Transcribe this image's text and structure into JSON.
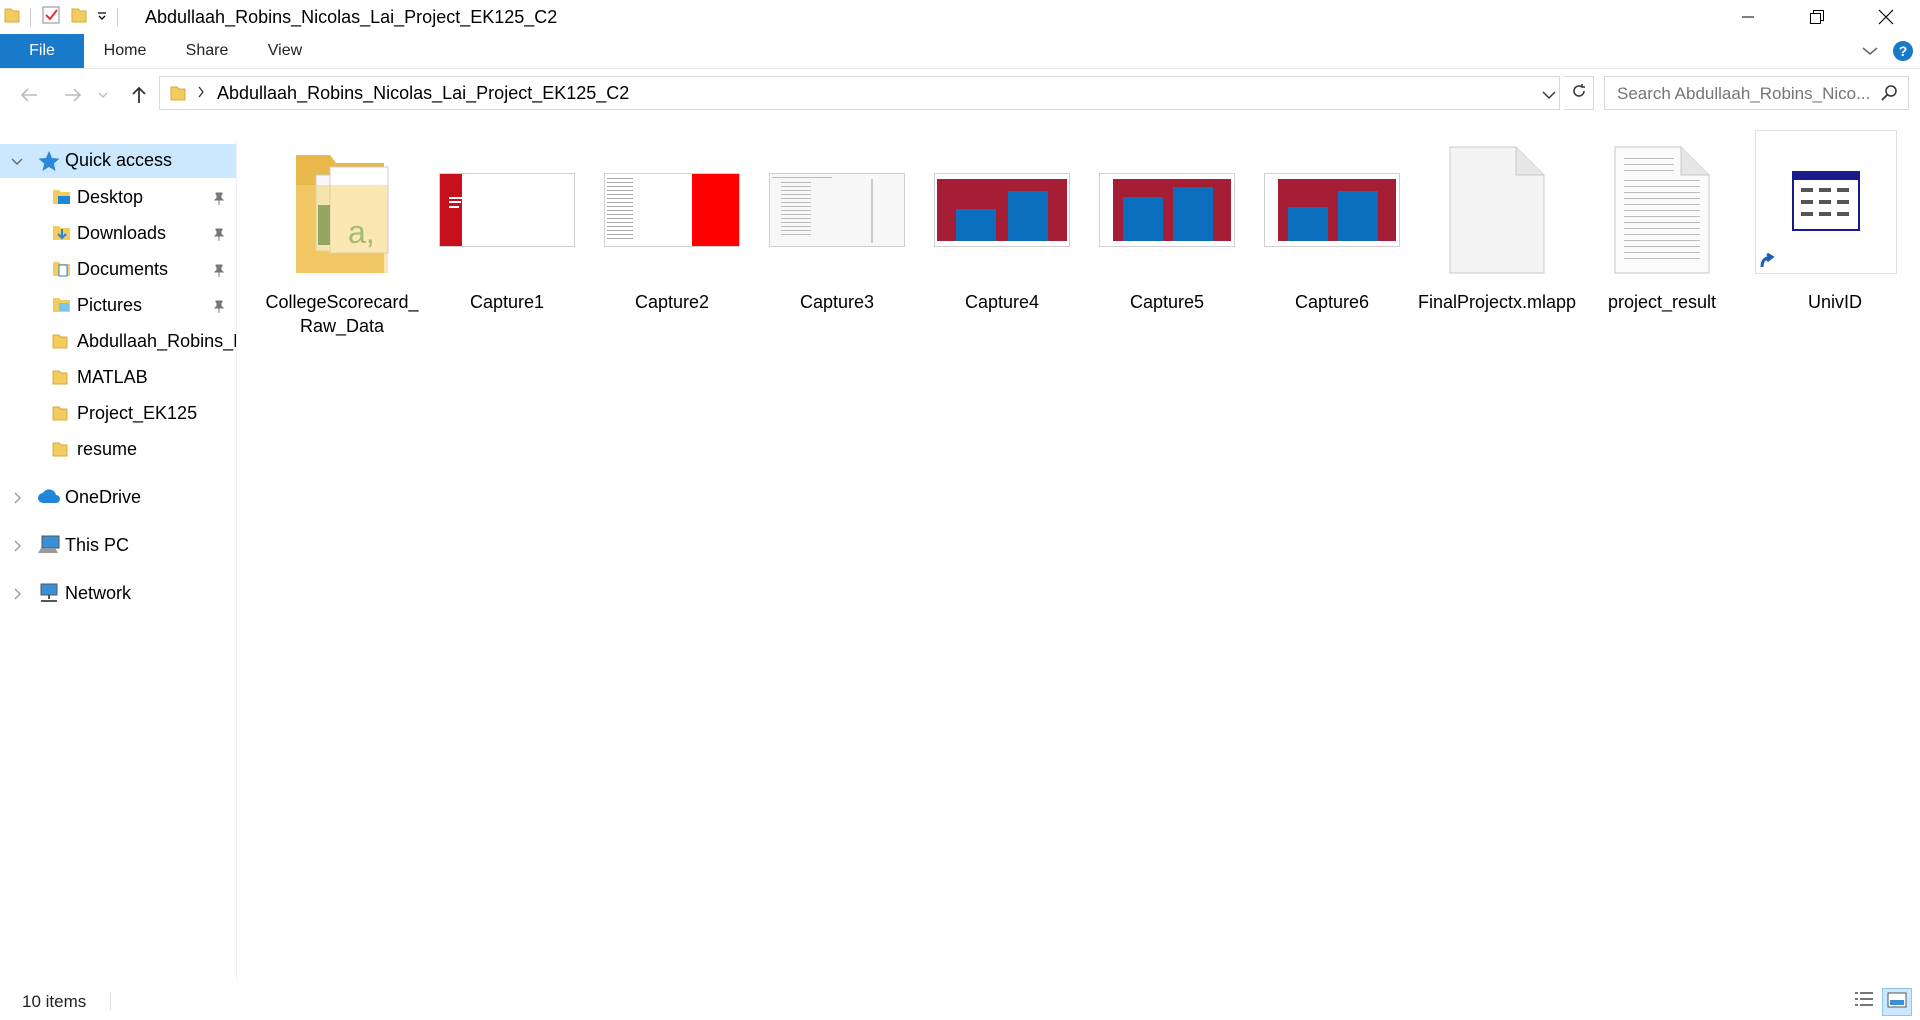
{
  "window": {
    "title": "Abdullaah_Robins_Nicolas_Lai_Project_EK125_C2"
  },
  "ribbon": {
    "tabs": [
      "File",
      "Home",
      "Share",
      "View"
    ]
  },
  "address": {
    "path": "Abdullaah_Robins_Nicolas_Lai_Project_EK125_C2",
    "search_placeholder": "Search Abdullaah_Robins_Nico..."
  },
  "sidebar": {
    "quick_access": "Quick access",
    "pinned": [
      "Desktop",
      "Downloads",
      "Documents",
      "Pictures"
    ],
    "recent": [
      "Abdullaah_Robins_N",
      "MATLAB",
      "Project_EK125",
      "resume"
    ],
    "onedrive": "OneDrive",
    "thispc": "This PC",
    "network": "Network"
  },
  "files": [
    {
      "name": "CollegeScorecard_Raw_Data",
      "icon": "folder-icon"
    },
    {
      "name": "Capture1",
      "icon": "image-thumbnail"
    },
    {
      "name": "Capture2",
      "icon": "image-thumbnail"
    },
    {
      "name": "Capture3",
      "icon": "image-thumbnail"
    },
    {
      "name": "Capture4",
      "icon": "bar-chart-thumbnail"
    },
    {
      "name": "Capture5",
      "icon": "bar-chart-thumbnail"
    },
    {
      "name": "Capture6",
      "icon": "bar-chart-thumbnail"
    },
    {
      "name": "FinalProjectx.mlapp",
      "icon": "blank-file-icon"
    },
    {
      "name": "project_result",
      "icon": "text-file-icon"
    },
    {
      "name": "UnivID",
      "icon": "table-shortcut-icon"
    }
  ],
  "status": {
    "item_count": "10 items"
  },
  "colors": {
    "accent": "#1979ca",
    "selection": "#cce8ff",
    "folder": "#f3cc5f",
    "chart_bg": "#a51e36",
    "chart_bar": "#0b6fc0"
  }
}
